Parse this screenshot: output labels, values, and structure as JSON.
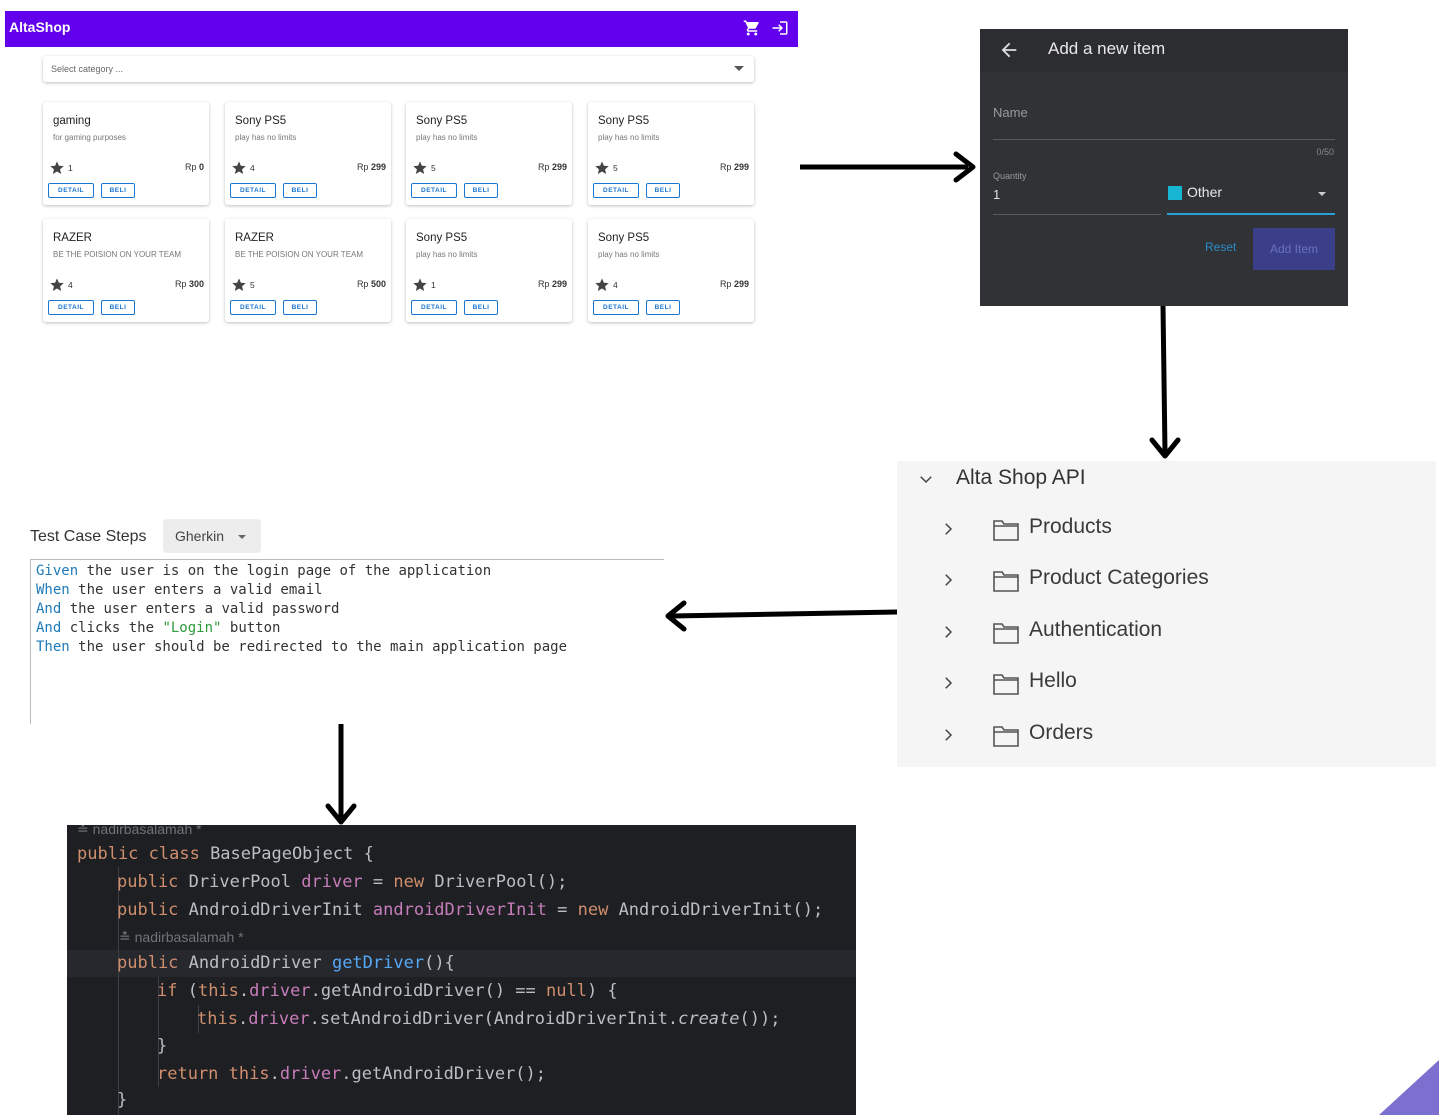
{
  "shop": {
    "brand": "AltaShop",
    "select_placeholder": "Select category ...",
    "products": [
      {
        "title": "gaming",
        "desc": "for gaming purposes",
        "rating": "1",
        "price_prefix": "Rp",
        "price": "0",
        "detail": "DETAIL",
        "beli": "BELI"
      },
      {
        "title": "Sony PS5",
        "desc": "play has no limits",
        "rating": "4",
        "price_prefix": "Rp",
        "price": "299",
        "detail": "DETAIL",
        "beli": "BELI"
      },
      {
        "title": "Sony PS5",
        "desc": "play has no limits",
        "rating": "5",
        "price_prefix": "Rp",
        "price": "299",
        "detail": "DETAIL",
        "beli": "BELI"
      },
      {
        "title": "Sony PS5",
        "desc": "play has no limits",
        "rating": "5",
        "price_prefix": "Rp",
        "price": "299",
        "detail": "DETAIL",
        "beli": "BELI"
      },
      {
        "title": "RAZER",
        "desc": "BE THE POISION ON YOUR TEAM",
        "rating": "4",
        "price_prefix": "Rp",
        "price": "300",
        "detail": "DETAIL",
        "beli": "BELI"
      },
      {
        "title": "RAZER",
        "desc": "BE THE POISION ON YOUR TEAM",
        "rating": "5",
        "price_prefix": "Rp",
        "price": "500",
        "detail": "DETAIL",
        "beli": "BELI"
      },
      {
        "title": "Sony PS5",
        "desc": "play has no limits",
        "rating": "1",
        "price_prefix": "Rp",
        "price": "299",
        "detail": "DETAIL",
        "beli": "BELI"
      },
      {
        "title": "Sony PS5",
        "desc": "play has no limits",
        "rating": "4",
        "price_prefix": "Rp",
        "price": "299",
        "detail": "DETAIL",
        "beli": "BELI"
      }
    ],
    "colors": {
      "appbar": "#6200ee",
      "button": "#1976d2"
    }
  },
  "add_item": {
    "title": "Add a new item",
    "name_label": "Name",
    "name_counter": "0/50",
    "quantity_label": "Quantity",
    "quantity_value": "1",
    "category_value": "Other",
    "reset_label": "Reset",
    "add_label": "Add Item",
    "colors": {
      "category_swatch": "#19b6d4"
    }
  },
  "api_tree": {
    "root": "Alta Shop API",
    "folders": [
      "Products",
      "Product Categories",
      "Authentication",
      "Hello",
      "Orders"
    ]
  },
  "test_case": {
    "label": "Test Case Steps",
    "format": "Gherkin",
    "steps": [
      {
        "keyword": "Given",
        "text": " the user is on the login page of the application"
      },
      {
        "keyword": "When",
        "text": " the user enters a valid email"
      },
      {
        "keyword": "And",
        "text": " the user enters a valid password"
      },
      {
        "keyword": "And",
        "text": " clicks the ",
        "quoted": "\"Login\"",
        "after": " button"
      },
      {
        "keyword": "Then",
        "text": " the user should be redirected to the main application page"
      }
    ]
  },
  "code": {
    "author_1": "nadirbasalamah *",
    "author_2": "nadirbasalamah *",
    "lines": {
      "l1_kw": "public class",
      "l1_rest": " BasePageObject {",
      "l2_kw": "public",
      "l2_mid": " DriverPool ",
      "l2_field": "driver",
      "l2_eq": " = ",
      "l2_new": "new",
      "l2_rest": " DriverPool();",
      "l3_kw": "public",
      "l3_mid": " AndroidDriverInit ",
      "l3_field": "androidDriverInit",
      "l3_eq": " = ",
      "l3_new": "new",
      "l3_rest": " AndroidDriverInit();",
      "l4_kw": "public",
      "l4_mid": " AndroidDriver ",
      "l4_method": "getDriver",
      "l4_rest": "(){",
      "l5_kw": "if",
      "l5_a": " (",
      "l5_this": "this",
      "l5_b": ".",
      "l5_field": "driver",
      "l5_c": ".getAndroidDriver() == ",
      "l5_null": "null",
      "l5_d": ") {",
      "l6_this": "this",
      "l6_a": ".",
      "l6_field": "driver",
      "l6_b": ".setAndroidDriver(AndroidDriverInit.",
      "l6_call": "create",
      "l6_c": "());",
      "l7": "}",
      "l8_kw": "return",
      "l8_sp": " ",
      "l8_this": "this",
      "l8_a": ".",
      "l8_field": "driver",
      "l8_b": ".getAndroidDriver();",
      "l9": "}"
    }
  }
}
